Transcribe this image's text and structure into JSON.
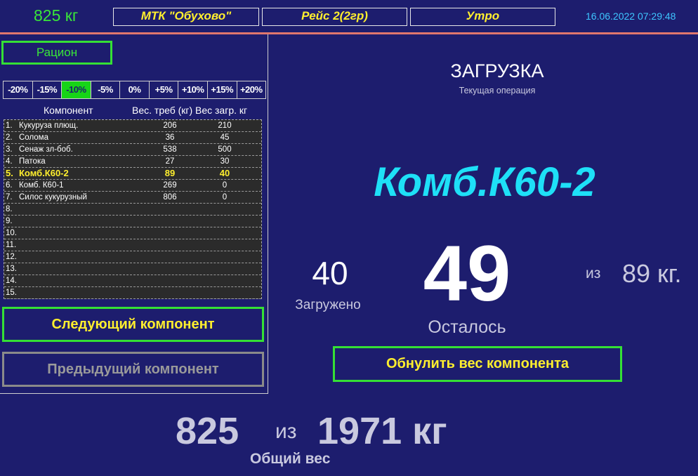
{
  "header": {
    "weight": "825 кг",
    "farm": "МТК \"Обухово\"",
    "trip": "Рейс 2(2гр)",
    "shift": "Утро",
    "datetime": "16.06.2022 07:29:48"
  },
  "left": {
    "ration_button": "Рацион",
    "percent_options": [
      "-20%",
      "-15%",
      "-10%",
      "-5%",
      "0%",
      "+5%",
      "+10%",
      "+15%",
      "+20%"
    ],
    "percent_selected": "-10%",
    "columns": [
      "Компонент",
      "Вес. треб (кг)",
      "Вес загр. кг"
    ],
    "rows": [
      {
        "num": "1.",
        "name": "Кукуруза плющ.",
        "req": "206",
        "load": "210"
      },
      {
        "num": "2.",
        "name": "Солома",
        "req": "36",
        "load": "45"
      },
      {
        "num": "3.",
        "name": "Сенаж зл-боб.",
        "req": "538",
        "load": "500"
      },
      {
        "num": "4.",
        "name": "Патока",
        "req": "27",
        "load": "30"
      },
      {
        "num": "5.",
        "name": "Комб.К60-2",
        "req": "89",
        "load": "40",
        "current": true
      },
      {
        "num": "6.",
        "name": "Комб. К60-1",
        "req": "269",
        "load": "0"
      },
      {
        "num": "7.",
        "name": "Силос кукурузный",
        "req": "806",
        "load": "0"
      },
      {
        "num": "8.",
        "name": "",
        "req": "",
        "load": ""
      },
      {
        "num": "9.",
        "name": "",
        "req": "",
        "load": ""
      },
      {
        "num": "10.",
        "name": "",
        "req": "",
        "load": ""
      },
      {
        "num": "11.",
        "name": "",
        "req": "",
        "load": ""
      },
      {
        "num": "12.",
        "name": "",
        "req": "",
        "load": ""
      },
      {
        "num": "13.",
        "name": "",
        "req": "",
        "load": ""
      },
      {
        "num": "14.",
        "name": "",
        "req": "",
        "load": ""
      },
      {
        "num": "15.",
        "name": "",
        "req": "",
        "load": ""
      }
    ],
    "next_button": "Следующий компонент",
    "prev_button": "Предыдущий компонент"
  },
  "operation": {
    "title": "ЗАГРУЗКА",
    "subtitle": "Текущая операция",
    "component": "Комб.К60-2",
    "loaded_value": "40",
    "loaded_label": "Загружено",
    "remaining_value": "49",
    "remaining_label": "Осталось",
    "of_label": "из",
    "component_total": "89 кг.",
    "reset_button": "Обнулить вес компонента"
  },
  "totals": {
    "current": "825",
    "of_label": "из",
    "total": "1971 кг",
    "label": "Общий вес"
  },
  "colors": {
    "background": "#1d1d6e",
    "accent_green": "#35e035",
    "accent_yellow": "#ffef2e",
    "accent_cyan": "#1ee0f7"
  }
}
